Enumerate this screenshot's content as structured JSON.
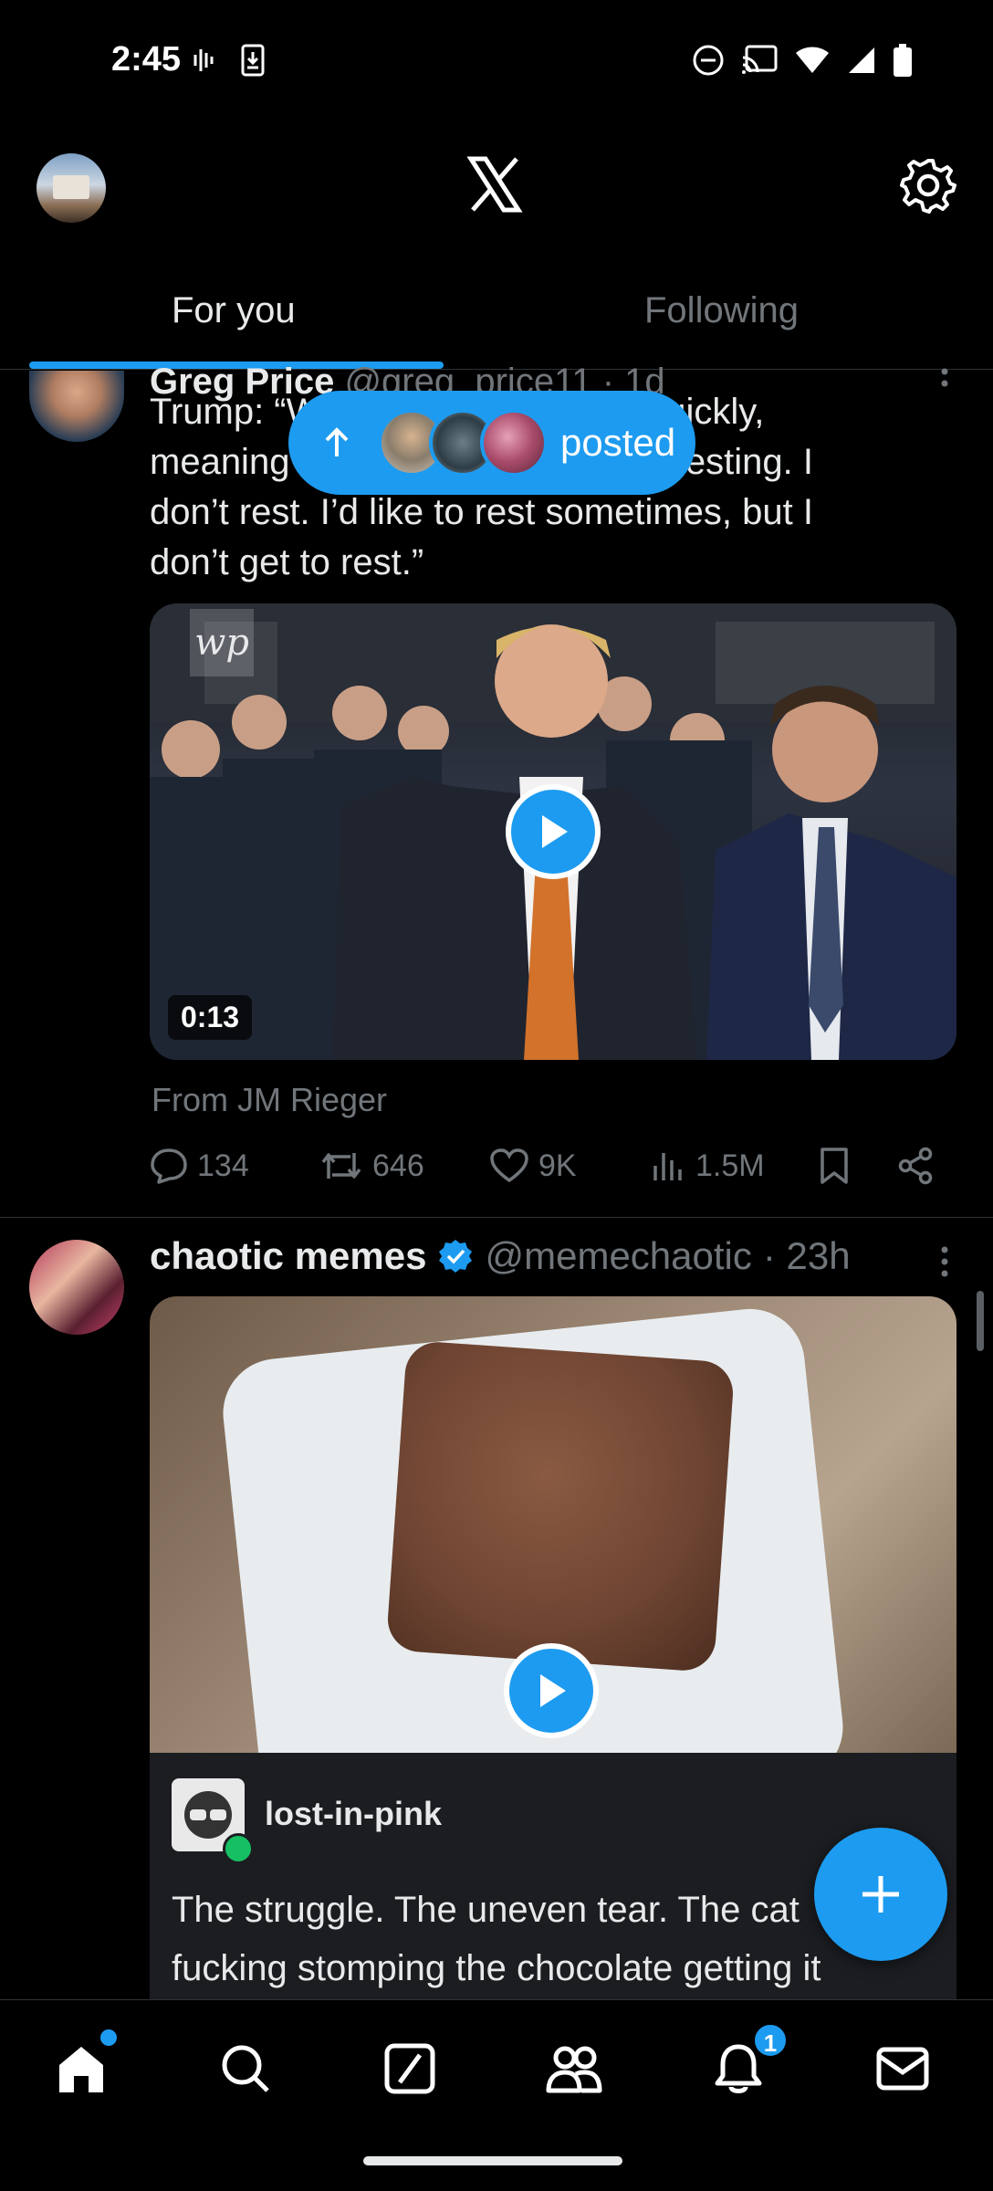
{
  "status_bar": {
    "time": "2:45",
    "icons": [
      "voicemail-icon",
      "download-icon",
      "do-not-disturb-icon",
      "cast-icon",
      "wifi-icon",
      "signal-icon",
      "battery-icon"
    ]
  },
  "header": {
    "logo": "x-logo",
    "settings_icon": "gear-icon"
  },
  "tabs": [
    {
      "label": "For you",
      "active": true
    },
    {
      "label": "Following",
      "active": false
    }
  ],
  "new_posts_pill": {
    "label": "posted",
    "icon": "arrow-up-icon"
  },
  "tweet1": {
    "name": "Greg Price",
    "handle": "@greg_price11",
    "time": "· 1d",
    "text_lines": [
      "Trump: “W                                quickly,",
      "meaning                              ’t be resting. I",
      "don’t rest. I’d like to rest sometimes, but I",
      "don’t get to rest.”"
    ],
    "media": {
      "type": "video",
      "duration": "0:13",
      "watermark": "wp"
    },
    "from": "From JM Rieger",
    "stats": {
      "replies": "134",
      "reposts": "646",
      "likes": "9K",
      "views": "1.5M"
    }
  },
  "tweet2": {
    "name": "chaotic memes",
    "handle": "@memechaotic",
    "time": "· 23h",
    "media": {
      "type": "video"
    },
    "quote": {
      "author": "lost-in-pink",
      "text_lines": [
        "The struggle. The uneven tear. The cat",
        "fucking stomping the chocolate getting it"
      ]
    }
  },
  "fab": {
    "icon": "plus-icon"
  },
  "bottom_nav": {
    "items": [
      "home-icon",
      "search-icon",
      "grok-icon",
      "communities-icon",
      "notifications-icon",
      "messages-icon"
    ],
    "notifications_badge": "1"
  },
  "colors": {
    "accent": "#1d9bf0",
    "background": "#000000",
    "text": "#e7e9ea",
    "muted": "#71767b",
    "divider": "#2f3336"
  }
}
